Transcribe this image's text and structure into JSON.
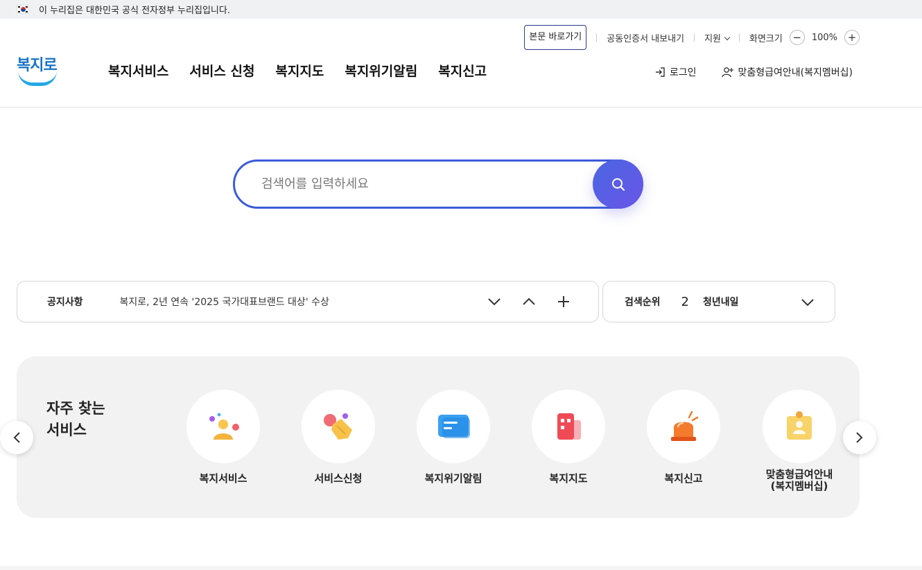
{
  "banner": {
    "text": "이 누리집은 대한민국 공식 전자정부 누리집입니다."
  },
  "utility": {
    "skip": "본문 바로가기",
    "cert": "공동인증서 내보내기",
    "support": "지원",
    "zoom_label": "화면크기",
    "zoom_minus": "−",
    "zoom_value": "100%",
    "zoom_plus": "+"
  },
  "logo": {
    "text": "복지로"
  },
  "gnb": [
    "복지서비스",
    "서비스 신청",
    "복지지도",
    "복지위기알림",
    "복지신고"
  ],
  "member": {
    "login": "로그인",
    "membership": "맞춤형급여안내(복지멤버십)"
  },
  "search": {
    "placeholder": "검색어를 입력하세요"
  },
  "notice": {
    "label": "공지사항",
    "text": "복지로, 2년 연속 '2025 국가대표브랜드 대상' 수상"
  },
  "rank": {
    "label": "검색순위",
    "number": "2",
    "keyword": "청년내일"
  },
  "frequent": {
    "title_line1": "자주 찾는",
    "title_line2": "서비스",
    "items": [
      {
        "label": "복지서비스"
      },
      {
        "label": "서비스신청"
      },
      {
        "label": "복지위기알림"
      },
      {
        "label": "복지지도"
      },
      {
        "label": "복지신고"
      },
      {
        "label_line1": "맞춤형급여안내",
        "label_line2": "(복지멤버십)"
      }
    ]
  },
  "colors": {
    "primary": "#3b5bd9",
    "logo_blue": "#1a73c8",
    "logo_smile": "#26a8e6",
    "panel_bg": "#f2f2f2"
  }
}
